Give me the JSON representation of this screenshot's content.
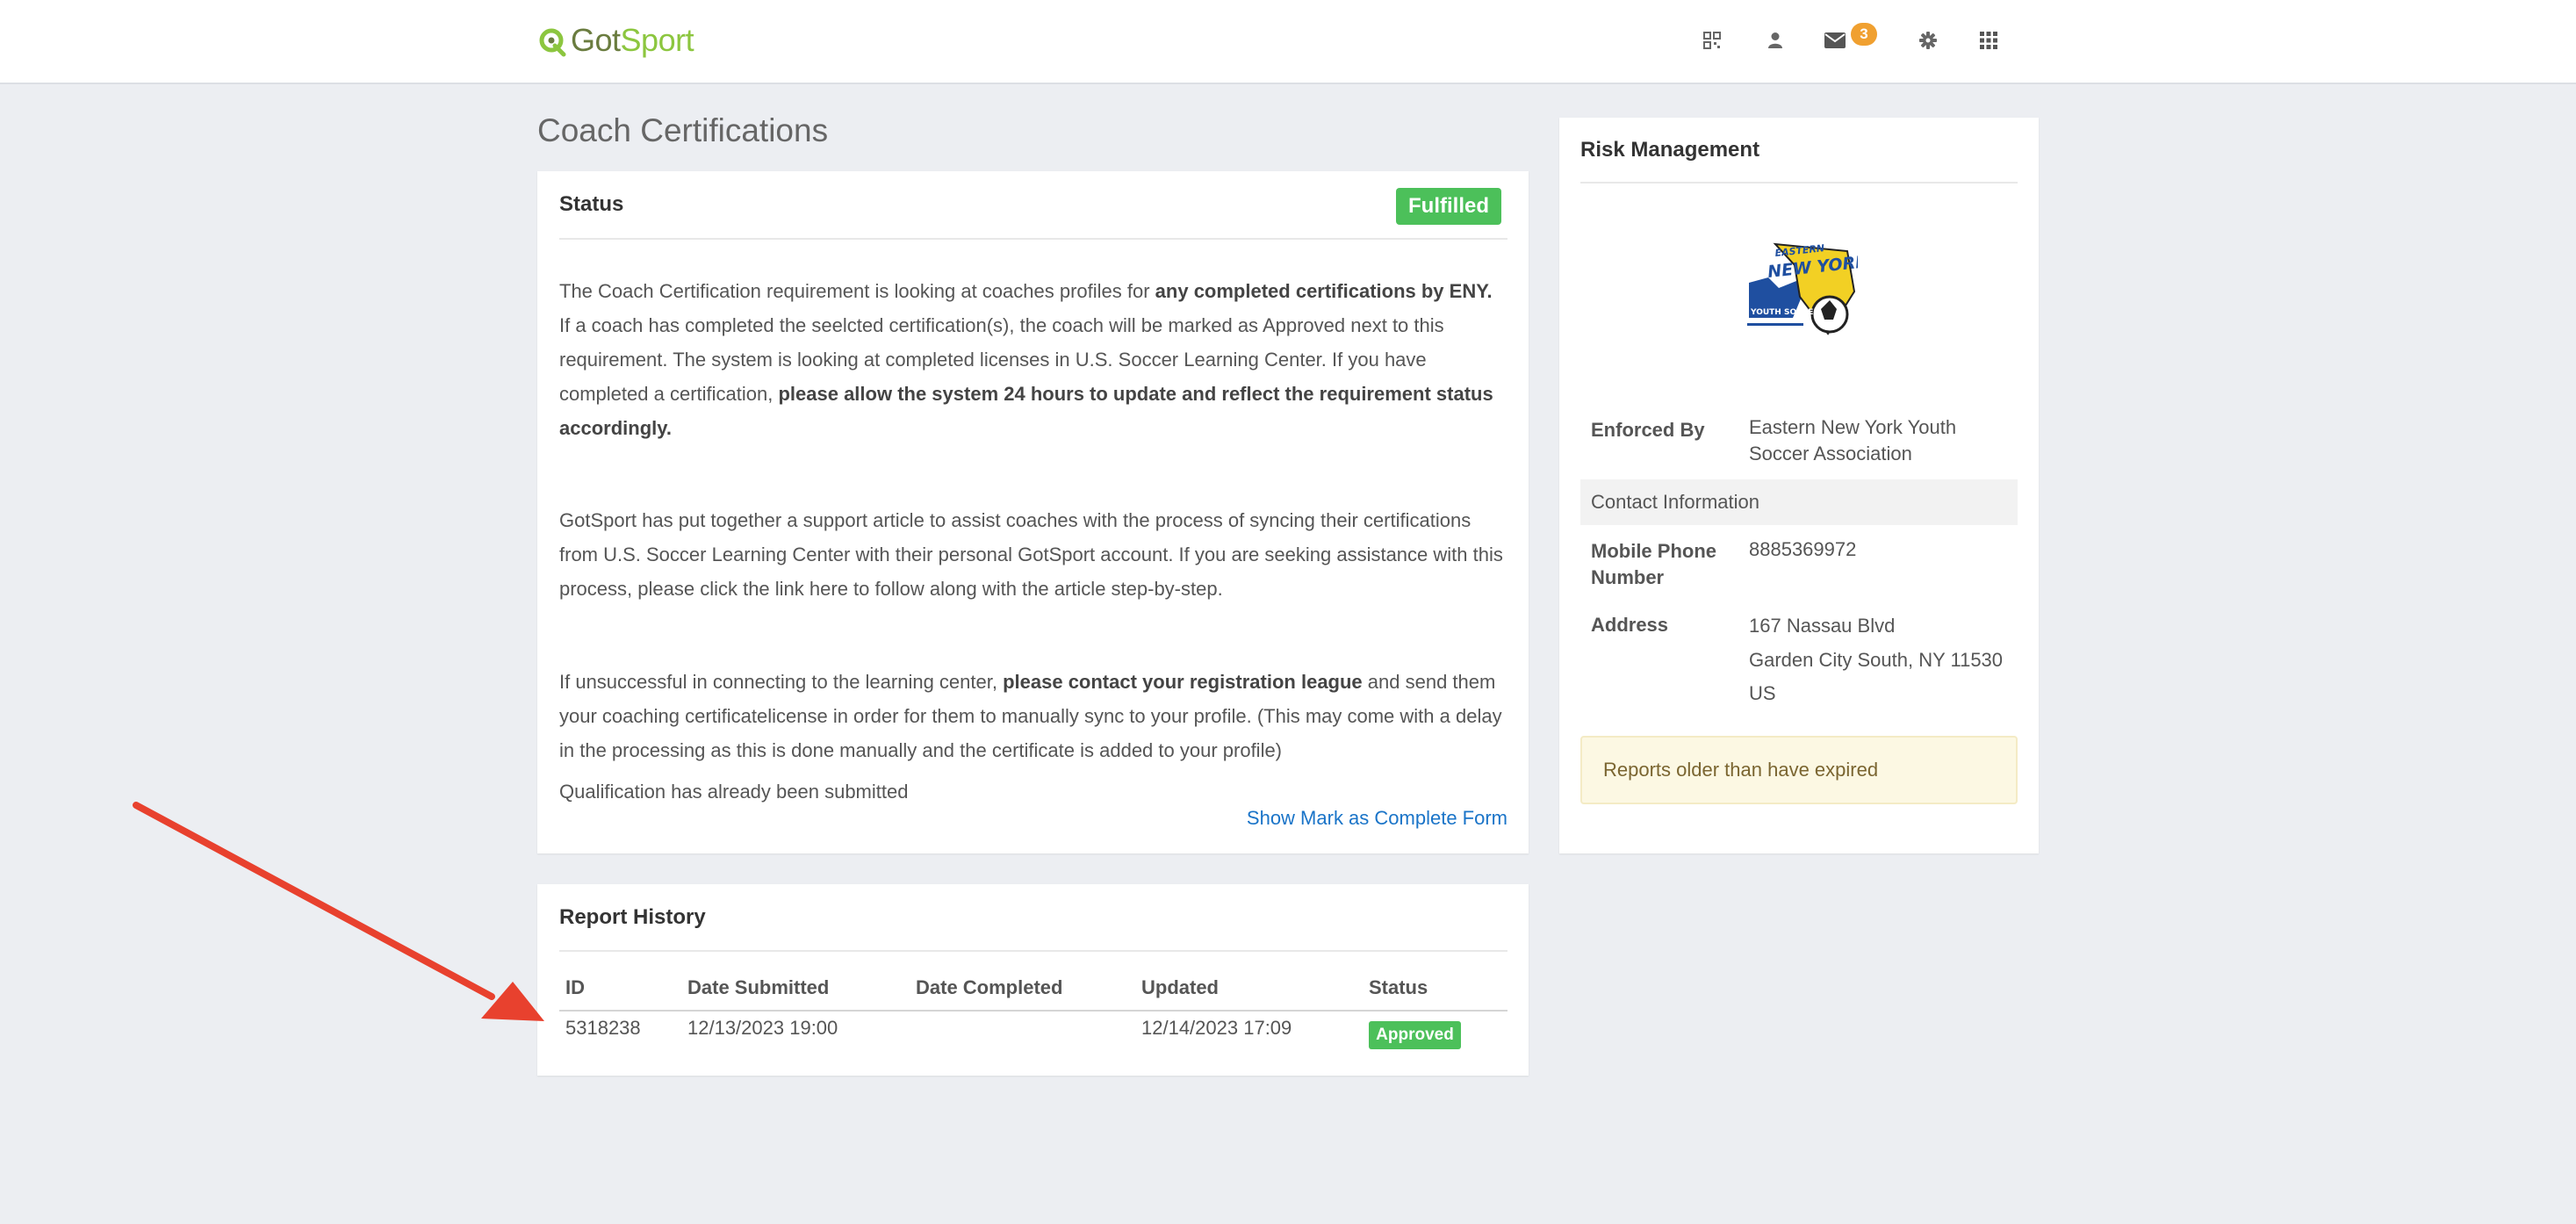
{
  "brand": {
    "got": "Got",
    "sport": "Sport"
  },
  "nav": {
    "icons": [
      "qr-code-icon",
      "user-icon",
      "envelope-icon",
      "gear-icon",
      "apps-grid-icon"
    ],
    "mail_count": "3"
  },
  "page_title": "Coach Certifications",
  "status_card": {
    "title": "Status",
    "badge": "Fulfilled",
    "para1": {
      "t1": "The Coach Certification requirement is looking at coaches profiles for ",
      "b1": "any completed certifications by ENY.",
      "t2": " If a coach has completed the seelcted certification(s), the coach will be marked as Approved next to this requirement. The system is looking at completed licenses in U.S. Soccer Learning Center. If you have completed a certification, ",
      "b2": "please allow the system 24 hours to update and reflect the requirement status accordingly."
    },
    "para2": "GotSport has put together a support article to assist coaches with the process of syncing their certifications from U.S. Soccer Learning Center with their personal GotSport account. If you are seeking assistance with this process, please click the link here to follow along with the article step-by-step.",
    "para3": {
      "t1": "If unsuccessful in connecting to the learning center, ",
      "b1": "please contact your registration league",
      "t2": " and send them your coaching certificatelicense in order for them to manually sync to your profile. (This may come with a delay in the processing as this is done manually and the certificate is added to your profile)"
    },
    "submitted_note": "Qualification has already been submitted",
    "form_link": "Show Mark as Complete Form"
  },
  "report_history": {
    "title": "Report History",
    "columns": [
      "ID",
      "Date Submitted",
      "Date Completed",
      "Updated",
      "Status"
    ],
    "rows": [
      {
        "id": "5318238",
        "date_submitted": "12/13/2023 19:00",
        "date_completed": "",
        "updated": "12/14/2023 17:09",
        "status": "Approved"
      }
    ]
  },
  "risk_management": {
    "title": "Risk Management",
    "logo_text": {
      "line1": "EASTERN",
      "line2": "NEW YORK",
      "line3": "YOUTH SOCCER"
    },
    "enforced_by_label": "Enforced By",
    "enforced_by_line1": "Eastern New York Youth",
    "enforced_by_line2": "Soccer Association",
    "contact_info": "Contact Information",
    "mobile_label_1": "Mobile Phone",
    "mobile_label_2": "Number",
    "mobile_value": "8885369972",
    "address_label": "Address",
    "address_line1": "167 Nassau Blvd",
    "address_line2": "Garden City South, NY 11530",
    "address_line3": "US",
    "reports_note": "Reports older than have expired"
  },
  "colors": {
    "accent_green": "#4cc05a",
    "link_blue": "#1a74c8",
    "badge_orange": "#f0a030",
    "annotation_arrow": "#e8412e"
  }
}
